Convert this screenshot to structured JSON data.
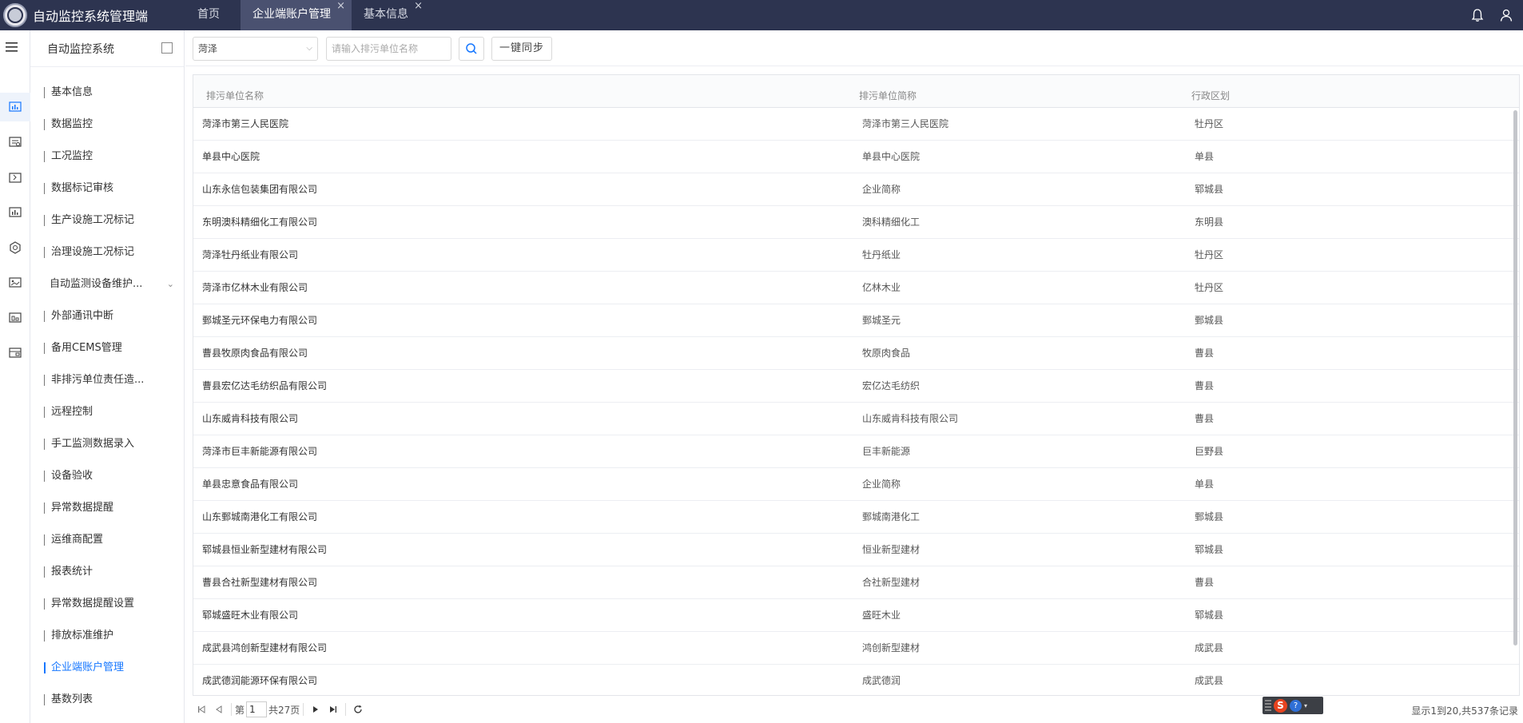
{
  "app": {
    "title": "自动监控系统管理端"
  },
  "tabs": [
    {
      "label": "首页",
      "closable": false,
      "active": false
    },
    {
      "label": "企业端账户管理",
      "closable": true,
      "active": true,
      "close": "×"
    },
    {
      "label": "基本信息",
      "closable": true,
      "active": false,
      "close": "×"
    }
  ],
  "topbar": {
    "icons": [
      "bell-icon",
      "user-icon"
    ]
  },
  "rail": {
    "icons": [
      "chart-monitor-icon",
      "list-icon",
      "doc-icon",
      "bar-chart-icon",
      "settings-gear-icon",
      "image-icon",
      "building-icon",
      "server-icon"
    ]
  },
  "sidebar": {
    "title": "自动监控系统",
    "items": [
      {
        "label": "基本信息"
      },
      {
        "label": "数据监控"
      },
      {
        "label": "工况监控"
      },
      {
        "label": "数据标记审核"
      },
      {
        "label": "生产设施工况标记"
      },
      {
        "label": "治理设施工况标记"
      },
      {
        "label": "自动监测设备维护...",
        "expandable": true
      },
      {
        "label": "外部通讯中断"
      },
      {
        "label": "备用CEMS管理"
      },
      {
        "label": "非排污单位责任造..."
      },
      {
        "label": "远程控制"
      },
      {
        "label": "手工监测数据录入"
      },
      {
        "label": "设备验收"
      },
      {
        "label": "异常数据提醒"
      },
      {
        "label": "运维商配置"
      },
      {
        "label": "报表统计"
      },
      {
        "label": "异常数据提醒设置"
      },
      {
        "label": "排放标准维护"
      },
      {
        "label": "企业端账户管理",
        "active": true
      },
      {
        "label": "基数列表"
      }
    ]
  },
  "toolbar": {
    "region_value": "菏泽",
    "search_placeholder": "请输入排污单位名称",
    "sync_label": "一键同步"
  },
  "table": {
    "columns": [
      "排污单位名称",
      "排污单位简称",
      "行政区划"
    ],
    "rows": [
      [
        "菏泽市第三人民医院",
        "菏泽市第三人民医院",
        "牡丹区"
      ],
      [
        "单县中心医院",
        "单县中心医院",
        "单县"
      ],
      [
        "山东永信包装集团有限公司",
        "企业简称",
        "郓城县"
      ],
      [
        "东明澳科精细化工有限公司",
        "澳科精细化工",
        "东明县"
      ],
      [
        "菏泽牡丹纸业有限公司",
        "牡丹纸业",
        "牡丹区"
      ],
      [
        "菏泽市亿林木业有限公司",
        "亿林木业",
        "牡丹区"
      ],
      [
        "鄄城圣元环保电力有限公司",
        "鄄城圣元",
        "鄄城县"
      ],
      [
        "曹县牧原肉食品有限公司",
        "牧原肉食品",
        "曹县"
      ],
      [
        "曹县宏亿达毛纺织品有限公司",
        "宏亿达毛纺织",
        "曹县"
      ],
      [
        "山东威肯科技有限公司",
        "山东威肯科技有限公司",
        "曹县"
      ],
      [
        "菏泽市巨丰新能源有限公司",
        "巨丰新能源",
        "巨野县"
      ],
      [
        "单县忠意食品有限公司",
        "企业简称",
        "单县"
      ],
      [
        "山东鄄城南港化工有限公司",
        "鄄城南港化工",
        "鄄城县"
      ],
      [
        "郓城县恒业新型建材有限公司",
        "恒业新型建材",
        "郓城县"
      ],
      [
        "曹县合社新型建材有限公司",
        "合社新型建材",
        "曹县"
      ],
      [
        "郓城盛旺木业有限公司",
        "盛旺木业",
        "郓城县"
      ],
      [
        "成武县鸿创新型建材有限公司",
        "鸿创新型建材",
        "成武县"
      ],
      [
        "成武德润能源环保有限公司",
        "成武德润",
        "成武县"
      ]
    ]
  },
  "pager": {
    "page_prefix": "第",
    "current_page": "1",
    "page_suffix": "共27页",
    "summary": "显示1到20,共537条记录"
  },
  "ime": {
    "logo": "S",
    "help": "?"
  },
  "colors": {
    "topbar": "#2d3450",
    "active_tab": "#4a5170",
    "accent": "#1677ff"
  }
}
